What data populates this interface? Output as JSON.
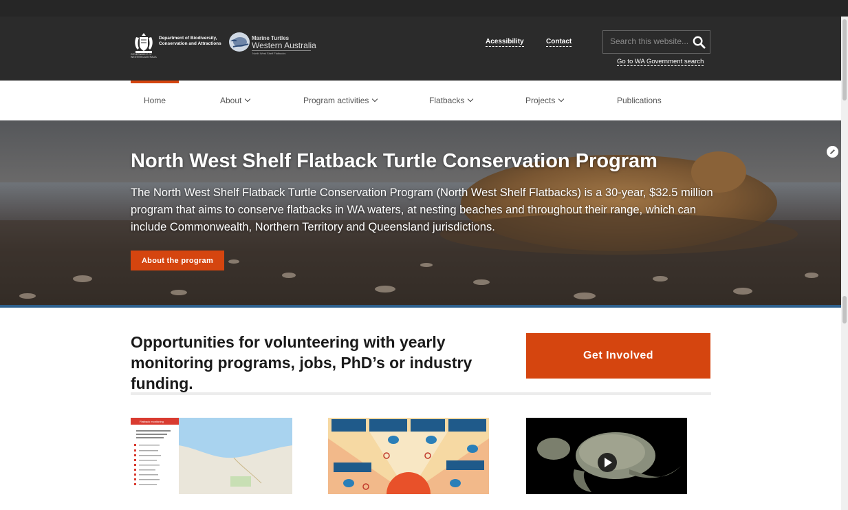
{
  "header": {
    "dept_name_line1": "Department of Biodiversity,",
    "dept_name_line2": "Conservation and Attractions",
    "gov_line1": "GOVERNMENT OF",
    "gov_line2": "WESTERN AUSTRALIA",
    "mt_title": "Marine Turtles",
    "mt_subtitle": "Western Australia",
    "mt_footer": "North West Shelf Flatbacks",
    "accessibility_link": "Acessibility",
    "contact_link": "Contact",
    "search_placeholder": "Search this website...",
    "gov_search_link": "Go to WA Government search"
  },
  "nav": {
    "items": [
      {
        "label": "Home",
        "active": true
      },
      {
        "label": "About",
        "dropdown": true
      },
      {
        "label": "Program activities",
        "dropdown": true
      },
      {
        "label": "Flatbacks",
        "dropdown": true
      },
      {
        "label": "Projects",
        "dropdown": true
      },
      {
        "label": "Publications"
      }
    ]
  },
  "hero": {
    "title": "North West Shelf Flatback Turtle Conservation Program",
    "text": "The North West Shelf Flatback Turtle Conservation Program (North West Shelf Flatbacks) is a 30-year, $32.5 million program that aims to conserve flatbacks in WA waters, at nesting beaches and throughout their range, which can include Commonwealth, Northern Territory and Queensland jurisdictions.",
    "button_label": "About the program"
  },
  "cta": {
    "heading": "Opportunities for volunteering with yearly monitoring programs, jobs, PhD’s or industry funding.",
    "button_label": "Get Involved"
  },
  "cards": [
    {
      "type": "map-app-screenshot",
      "app_title": "Flatback monitoring"
    },
    {
      "type": "infographic"
    },
    {
      "type": "video",
      "icon": "play-icon"
    }
  ],
  "colors": {
    "accent": "#d5450f",
    "header_bg": "#2b2b2b",
    "hero_line": "#2d5f8c"
  }
}
